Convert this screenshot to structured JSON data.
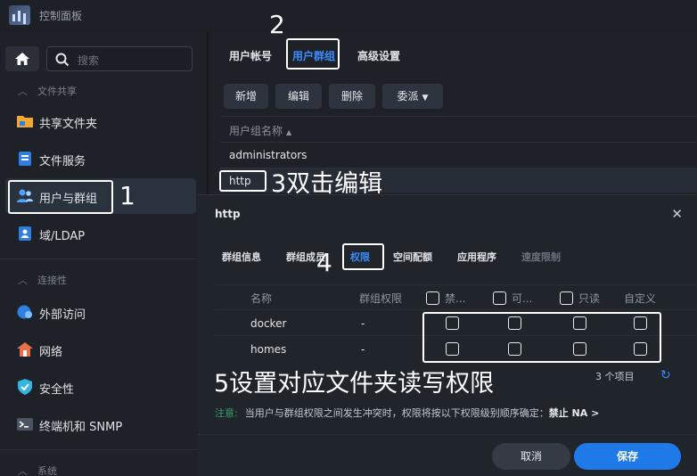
{
  "window": {
    "title": "控制面板"
  },
  "sidebar": {
    "search_placeholder": "搜索",
    "sections": [
      {
        "label": "文件共享"
      },
      {
        "label": "连接性"
      },
      {
        "label": "系统"
      }
    ],
    "items": [
      {
        "label": "共享文件夹",
        "icon": "folder-icon"
      },
      {
        "label": "文件服务",
        "icon": "file-services-icon"
      },
      {
        "label": "用户与群组",
        "icon": "users-icon",
        "active": true
      },
      {
        "label": "域/LDAP",
        "icon": "domain-icon"
      },
      {
        "label": "外部访问",
        "icon": "globe-icon"
      },
      {
        "label": "网络",
        "icon": "network-icon"
      },
      {
        "label": "安全性",
        "icon": "shield-icon"
      },
      {
        "label": "终端机和 SNMP",
        "icon": "terminal-icon"
      }
    ]
  },
  "main": {
    "tabs": [
      "用户帐号",
      "用户群组",
      "高级设置"
    ],
    "active_tab": "用户群组",
    "toolbar": {
      "create": "新增",
      "edit": "编辑",
      "delete": "删除",
      "delegate": "委派"
    },
    "column_header": "用户组名称",
    "rows": [
      "administrators",
      "http"
    ]
  },
  "dialog": {
    "title": "http",
    "tabs": [
      "群组信息",
      "群组成员",
      "权限",
      "空间配额",
      "应用程序",
      "速度限制"
    ],
    "active_tab": "权限",
    "columns": [
      "名称",
      "群组权限",
      "禁...",
      "可...",
      "只读",
      "自定义"
    ],
    "rows": [
      {
        "name": "docker",
        "group_perm": "-"
      },
      {
        "name": "homes",
        "group_perm": "-"
      }
    ],
    "count_text": "3 个项目",
    "note_label": "注意:",
    "note_text": "当用户与群组权限之间发生冲突时，权限将按以下权限级别顺序确定：",
    "note_order": "禁止 NA >",
    "cancel": "取消",
    "save": "保存"
  },
  "annotations": {
    "n1": "1",
    "n2": "2",
    "n3": "3双击编辑",
    "n4": "4",
    "n5": "5设置对应文件夹读写权限"
  },
  "colors": {
    "accent": "#3a8dff",
    "save": "#1f7ae8",
    "note_label": "#3aa06b"
  }
}
